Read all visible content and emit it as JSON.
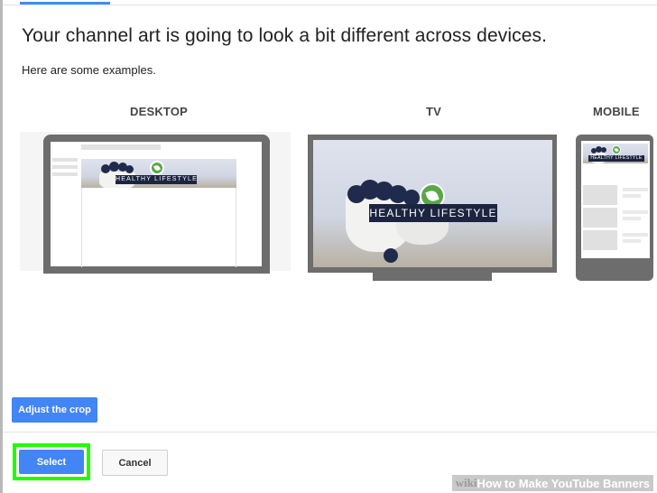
{
  "dialog": {
    "title": "Your channel art is going to look a bit different across devices.",
    "subtitle": "Here are some examples."
  },
  "devices": {
    "desktop_label": "DESKTOP",
    "tv_label": "TV",
    "mobile_label": "MOBILE"
  },
  "banner": {
    "text": "HEALTHY LIFESTYLE"
  },
  "buttons": {
    "adjust_crop": "Adjust the crop",
    "select": "Select",
    "cancel": "Cancel"
  },
  "watermark": {
    "wiki": "wiki",
    "howto": "How",
    "rest": "to Make YouTube Banners"
  },
  "colors": {
    "primary_button": "#4285f4",
    "highlight": "#1dff00",
    "device_frame": "#6d6d6d",
    "banner_label_bg": "#1c2540",
    "leaf_logo": "#59a847"
  }
}
